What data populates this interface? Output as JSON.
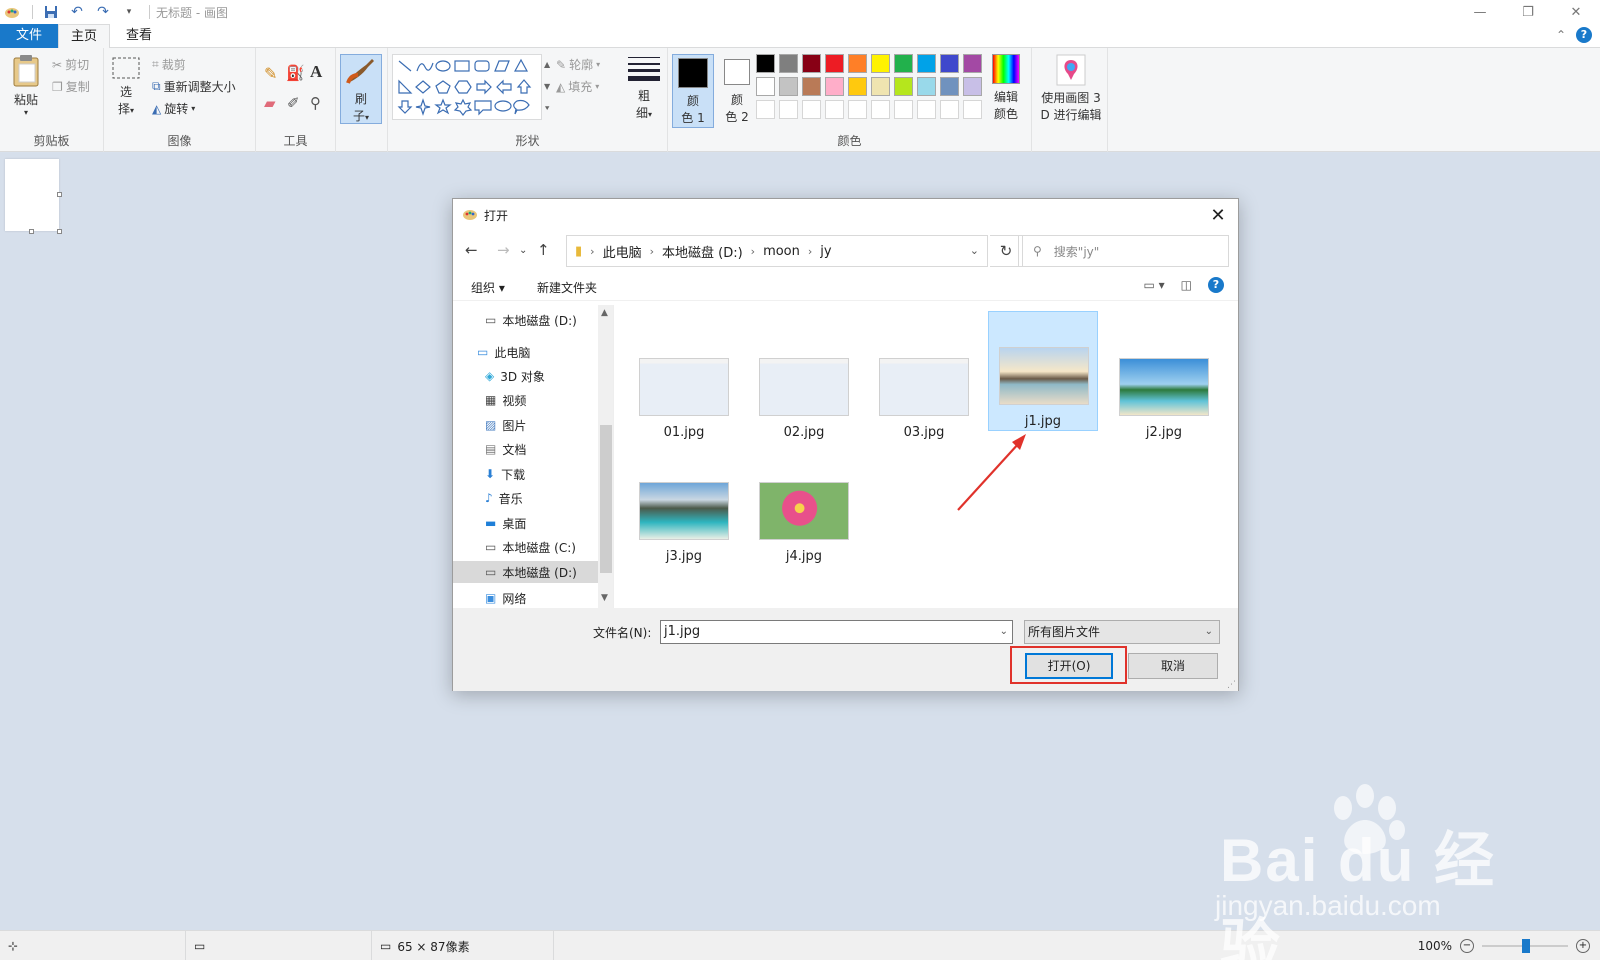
{
  "app": {
    "title": "无标题 - 画图"
  },
  "tabs": {
    "file": "文件",
    "home": "主页",
    "view": "查看"
  },
  "ribbon": {
    "clipboard": {
      "label": "剪贴板",
      "paste": "粘贴",
      "cut": "剪切",
      "copy": "复制"
    },
    "image": {
      "label": "图像",
      "select_top": "选",
      "select_bottom": "择",
      "crop": "裁剪",
      "resize": "重新调整大小",
      "rotate": "旋转"
    },
    "tools": {
      "label": "工具"
    },
    "brush": {
      "top": "刷",
      "bottom": "子"
    },
    "shapes": {
      "label": "形状",
      "outline": "轮廓",
      "fill": "填充"
    },
    "size": {
      "top": "粗",
      "bottom": "细"
    },
    "colors": {
      "label": "颜色",
      "color1_top": "颜",
      "color1_bottom": "色 1",
      "color2_top": "颜",
      "color2_bottom": "色 2",
      "edit_top": "编辑",
      "edit_bottom": "颜色",
      "palette_row1": [
        "#000000",
        "#7f7f7f",
        "#880015",
        "#ed1c24",
        "#ff7f27",
        "#fff200",
        "#22b14c",
        "#00a2e8",
        "#3f48cc",
        "#a349a4"
      ],
      "palette_row2": [
        "#ffffff",
        "#c3c3c3",
        "#b97a57",
        "#ffaec9",
        "#ffc90e",
        "#efe4b0",
        "#b5e61d",
        "#99d9ea",
        "#7092be",
        "#c8bfe7"
      ],
      "color1": "#000000",
      "color2": "#ffffff"
    },
    "paint3d": {
      "top": "使用画图 3",
      "bottom": "D 进行编辑"
    }
  },
  "dialog": {
    "title": "打开",
    "address": [
      "此电脑",
      "本地磁盘 (D:)",
      "moon",
      "jy"
    ],
    "search_placeholder": "搜索\"jy\"",
    "organize": "组织 ▾",
    "new_folder": "新建文件夹",
    "nav_items": [
      {
        "label": "本地磁盘 (D:)",
        "icon": "drive-icon"
      },
      {
        "label": "此电脑",
        "icon": "computer-icon"
      },
      {
        "label": "3D 对象",
        "icon": "cube-icon"
      },
      {
        "label": "视频",
        "icon": "video-icon"
      },
      {
        "label": "图片",
        "icon": "pictures-icon"
      },
      {
        "label": "文档",
        "icon": "documents-icon"
      },
      {
        "label": "下载",
        "icon": "download-icon"
      },
      {
        "label": "音乐",
        "icon": "music-icon"
      },
      {
        "label": "桌面",
        "icon": "desktop-icon"
      },
      {
        "label": "本地磁盘 (C:)",
        "icon": "drive-icon"
      },
      {
        "label": "本地磁盘 (D:)",
        "icon": "drive-icon"
      },
      {
        "label": "网络",
        "icon": "network-icon"
      }
    ],
    "files": [
      {
        "name": "01.jpg",
        "kind": "screenshot"
      },
      {
        "name": "02.jpg",
        "kind": "screenshot"
      },
      {
        "name": "03.jpg",
        "kind": "screenshot"
      },
      {
        "name": "j1.jpg",
        "kind": "beach-sunset",
        "selected": true
      },
      {
        "name": "j2.jpg",
        "kind": "tropical-beach"
      },
      {
        "name": "j3.jpg",
        "kind": "coastal-cove"
      },
      {
        "name": "j4.jpg",
        "kind": "pink-flower"
      }
    ],
    "filename_label": "文件名(N):",
    "filename_value": "j1.jpg",
    "filetype_value": "所有图片文件",
    "open_button": "打开(O)",
    "cancel_button": "取消"
  },
  "status": {
    "dimensions": "65 × 87像素",
    "zoom": "100%"
  },
  "watermark": {
    "brand": "Bai du 经验",
    "url": "jingyan.baidu.com"
  }
}
